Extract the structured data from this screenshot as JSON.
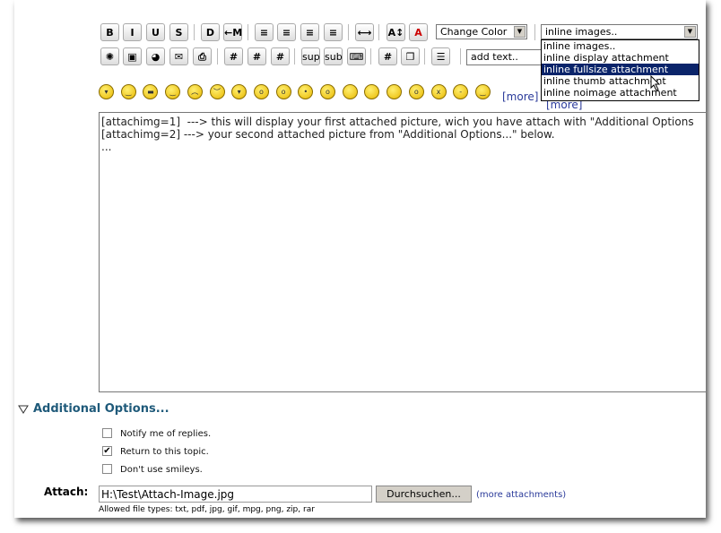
{
  "toolbar": {
    "row1": [
      {
        "name": "bold",
        "label": "B"
      },
      {
        "name": "italic",
        "label": "I"
      },
      {
        "name": "underline",
        "label": "U"
      },
      {
        "name": "strikethrough",
        "label": "S"
      },
      {
        "name": "glow",
        "label": "D"
      },
      {
        "name": "move",
        "label": "←M"
      },
      {
        "name": "preformatted",
        "label": "≡"
      },
      {
        "name": "align-left",
        "label": "≡"
      },
      {
        "name": "align-center",
        "label": "≡"
      },
      {
        "name": "align-right",
        "label": "≡"
      },
      {
        "name": "horizontal-rule",
        "label": "⟷"
      },
      {
        "name": "font-size",
        "label": "A↕"
      },
      {
        "name": "font-face",
        "label": "A"
      }
    ],
    "row2": [
      {
        "name": "flash",
        "label": "✺"
      },
      {
        "name": "image",
        "label": "▣"
      },
      {
        "name": "url",
        "label": "◕"
      },
      {
        "name": "email",
        "label": "✉"
      },
      {
        "name": "ftp",
        "label": "⎙"
      },
      {
        "name": "table",
        "label": "#"
      },
      {
        "name": "table-row",
        "label": "#"
      },
      {
        "name": "table-column",
        "label": "#"
      },
      {
        "name": "superscript",
        "label": "sup"
      },
      {
        "name": "subscript",
        "label": "sub"
      },
      {
        "name": "teletype",
        "label": "⌨"
      },
      {
        "name": "code",
        "label": "#"
      },
      {
        "name": "quote",
        "label": "❐"
      },
      {
        "name": "list",
        "label": "☰"
      }
    ],
    "color_select": "Change Color",
    "inline_select": "inline images..",
    "add_text_select": "add text..",
    "inline_options": [
      "inline images..",
      "inline display attachment",
      "inline fullsize attachment",
      "inline thumb attachment",
      "inline noimage attachment"
    ],
    "highlighted_option": 2
  },
  "smileys": {
    "count": 18,
    "more1": "[more]",
    "more2": "[more]"
  },
  "editor": {
    "text": "[attachimg=1]  ---> this will display your first attached picture, wich you have attach with \"Additional Options\n[attachimg=2] ---> your second attached picture from \"Additional Options...\" below.\n..."
  },
  "options": {
    "title": "Additional Options...",
    "checkboxes": [
      {
        "label": "Notify me of replies.",
        "checked": false
      },
      {
        "label": "Return to this topic.",
        "checked": true
      },
      {
        "label": "Don't use smileys.",
        "checked": false
      }
    ]
  },
  "attach": {
    "label": "Attach:",
    "value": "H:\\Test\\Attach-Image.jpg",
    "browse": "Durchsuchen...",
    "more": "(more attachments)",
    "allowed": "Allowed file types: txt, pdf, jpg, gif, mpg, png, zip, rar"
  },
  "colors": {
    "link": "#2a3a9a",
    "heading": "#1f5a7a",
    "highlight": "#0a246a"
  }
}
